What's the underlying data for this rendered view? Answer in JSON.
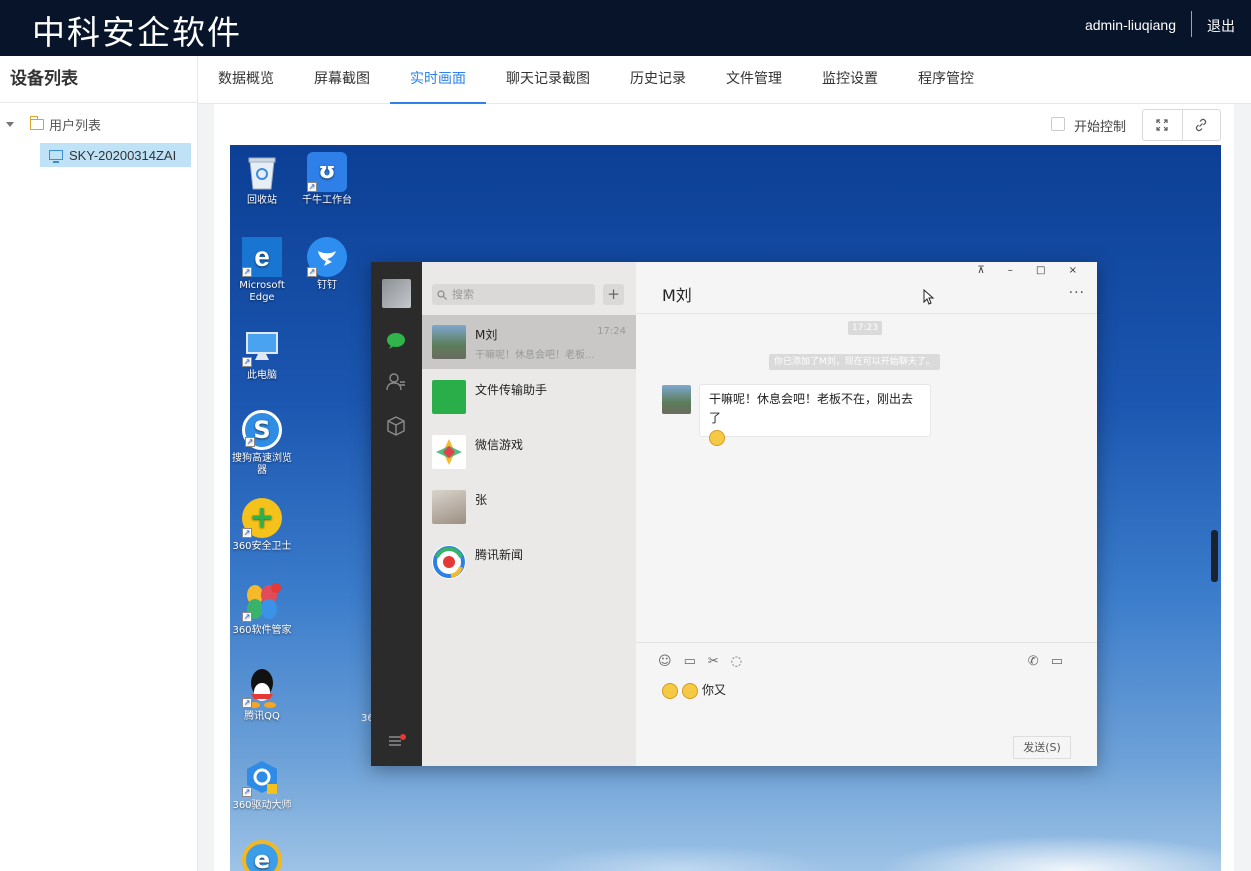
{
  "header": {
    "brand": "中科安企软件",
    "username": "admin-liuqiang",
    "logout_label": "退出"
  },
  "sidebar": {
    "title": "设备列表",
    "tree": {
      "root_label": "用户列表",
      "device_label": "SKY-20200314ZAI"
    }
  },
  "tabs": [
    {
      "label": "数据概览"
    },
    {
      "label": "屏幕截图"
    },
    {
      "label": "实时画面",
      "active": true
    },
    {
      "label": "聊天记录截图"
    },
    {
      "label": "历史记录"
    },
    {
      "label": "文件管理"
    },
    {
      "label": "监控设置"
    },
    {
      "label": "程序管控"
    }
  ],
  "toolbar": {
    "start_control_label": "开始控制",
    "start_control_checked": false
  },
  "desktop": {
    "icons": [
      {
        "label": "回收站",
        "icon": "recycle-bin-icon"
      },
      {
        "label": "千牛工作台",
        "icon": "qianniu-icon"
      },
      {
        "label": "Microsoft Edge",
        "icon": "edge-icon"
      },
      {
        "label": "钉钉",
        "icon": "dingtalk-icon"
      },
      {
        "label": "此电脑",
        "icon": "computer-icon"
      },
      {
        "label": "搜狗高速浏览器",
        "icon": "sogou-browser-icon"
      },
      {
        "label": "360安全卫士",
        "icon": "360-security-icon"
      },
      {
        "label": "360软件管家",
        "icon": "360-software-icon"
      },
      {
        "label": "腾讯QQ",
        "icon": "qq-icon"
      },
      {
        "label": "360驱动大师",
        "icon": "360-driver-icon"
      }
    ],
    "partial_text": "36"
  },
  "wechat": {
    "search_placeholder": "搜索",
    "plus_label": "+",
    "contacts": [
      {
        "name": "M刘",
        "time": "17:24",
        "preview": "干嘛呢！休息会吧！老板...",
        "selected": true
      },
      {
        "name": "文件传输助手"
      },
      {
        "name": "微信游戏"
      },
      {
        "name": "张"
      },
      {
        "name": "腾讯新闻"
      }
    ],
    "chat": {
      "title": "M刘",
      "window_buttons": "⊼ – □ ×",
      "more": "···",
      "time_stamp": "17:23",
      "system_message": "你已添加了M刘，现在可以开始聊天了。",
      "message_text": "干嘛呢！休息会吧！老板不在，刚出去了",
      "typed_text": "你又",
      "send_label": "发送(S)"
    }
  },
  "colors": {
    "header_bg": "#07142a",
    "accent": "#2e82e8",
    "selected_node_bg": "#bfe2f6"
  }
}
